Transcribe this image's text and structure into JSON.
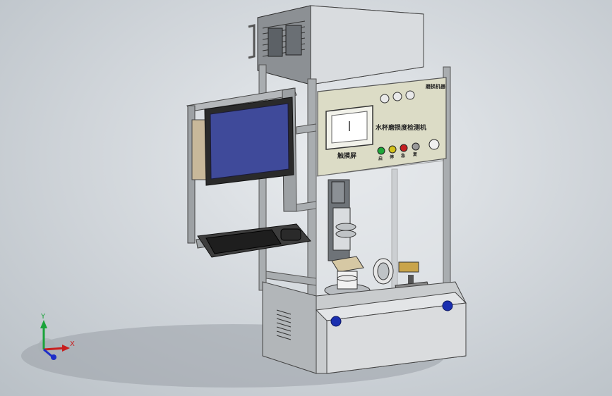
{
  "panel": {
    "title": "水杯磨损度检测机",
    "sub_label": "触摸屏",
    "corner_label": "磨损机器",
    "button_labels": [
      "启",
      "停",
      "急",
      "复"
    ]
  },
  "axes": {
    "y_label": "Y",
    "x_label": "X"
  },
  "colors": {
    "screen_blue": "#3f4a9a",
    "panel_beige": "#dcdcc6",
    "frame_grey": "#a9adb0",
    "cabinet_grey": "#c9ccce"
  }
}
